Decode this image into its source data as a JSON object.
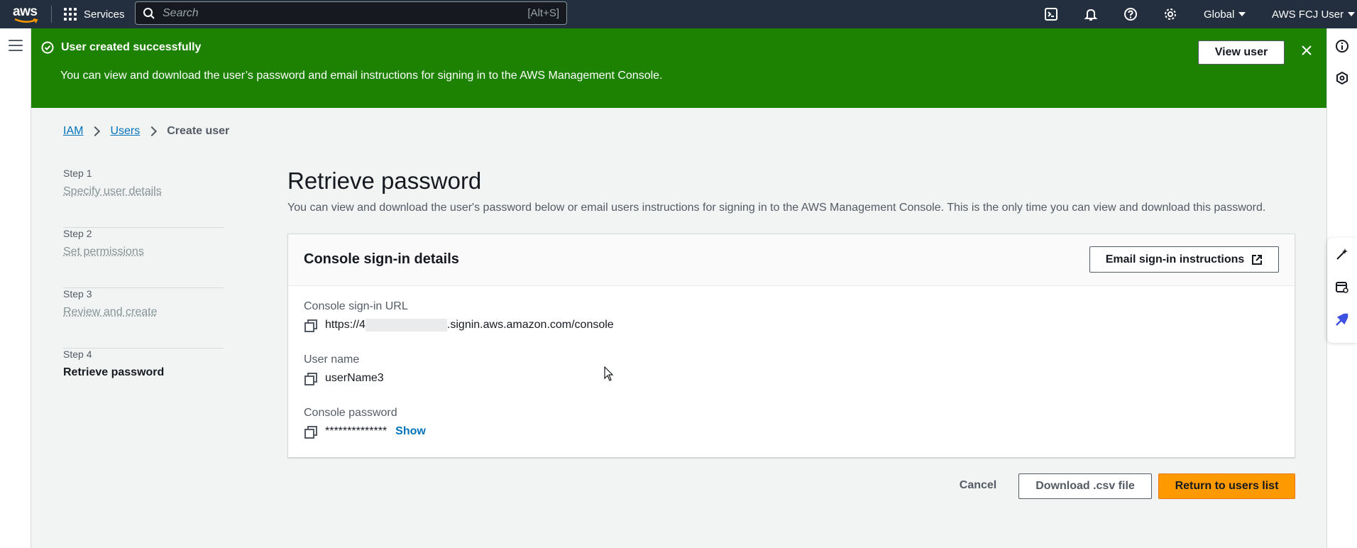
{
  "topnav": {
    "logo_text": "aws",
    "services_label": "Services",
    "search_placeholder": "Search",
    "search_shortcut": "[Alt+S]",
    "region_label": "Global",
    "account_label": "AWS FCJ User"
  },
  "flash": {
    "title": "User created successfully",
    "message": "You can view and download the user’s password and email instructions for signing in to the AWS Management Console.",
    "action_label": "View user",
    "color": "#1d8102"
  },
  "breadcrumb": {
    "items": [
      {
        "label": "IAM"
      },
      {
        "label": "Users"
      },
      {
        "label": "Create user"
      }
    ]
  },
  "steps": [
    {
      "num": "Step 1",
      "name": "Specify user details"
    },
    {
      "num": "Step 2",
      "name": "Set permissions"
    },
    {
      "num": "Step 3",
      "name": "Review and create"
    },
    {
      "num": "Step 4",
      "name": "Retrieve password"
    }
  ],
  "main": {
    "title": "Retrieve password",
    "subtitle": "You can view and download the user's password below or email users instructions for signing in to the AWS Management Console. This is the only time you can view and download this password."
  },
  "card": {
    "title": "Console sign-in details",
    "email_button": "Email sign-in instructions",
    "url_label": "Console sign-in URL",
    "url_prefix": "https://4",
    "url_suffix": ".signin.aws.amazon.com/console",
    "username_label": "User name",
    "username_value": "userName3",
    "password_label": "Console password",
    "password_value": "**************",
    "show_label": "Show"
  },
  "actions": {
    "cancel": "Cancel",
    "download": "Download .csv file",
    "primary": "Return to users list",
    "primary_color": "#ff9900"
  }
}
